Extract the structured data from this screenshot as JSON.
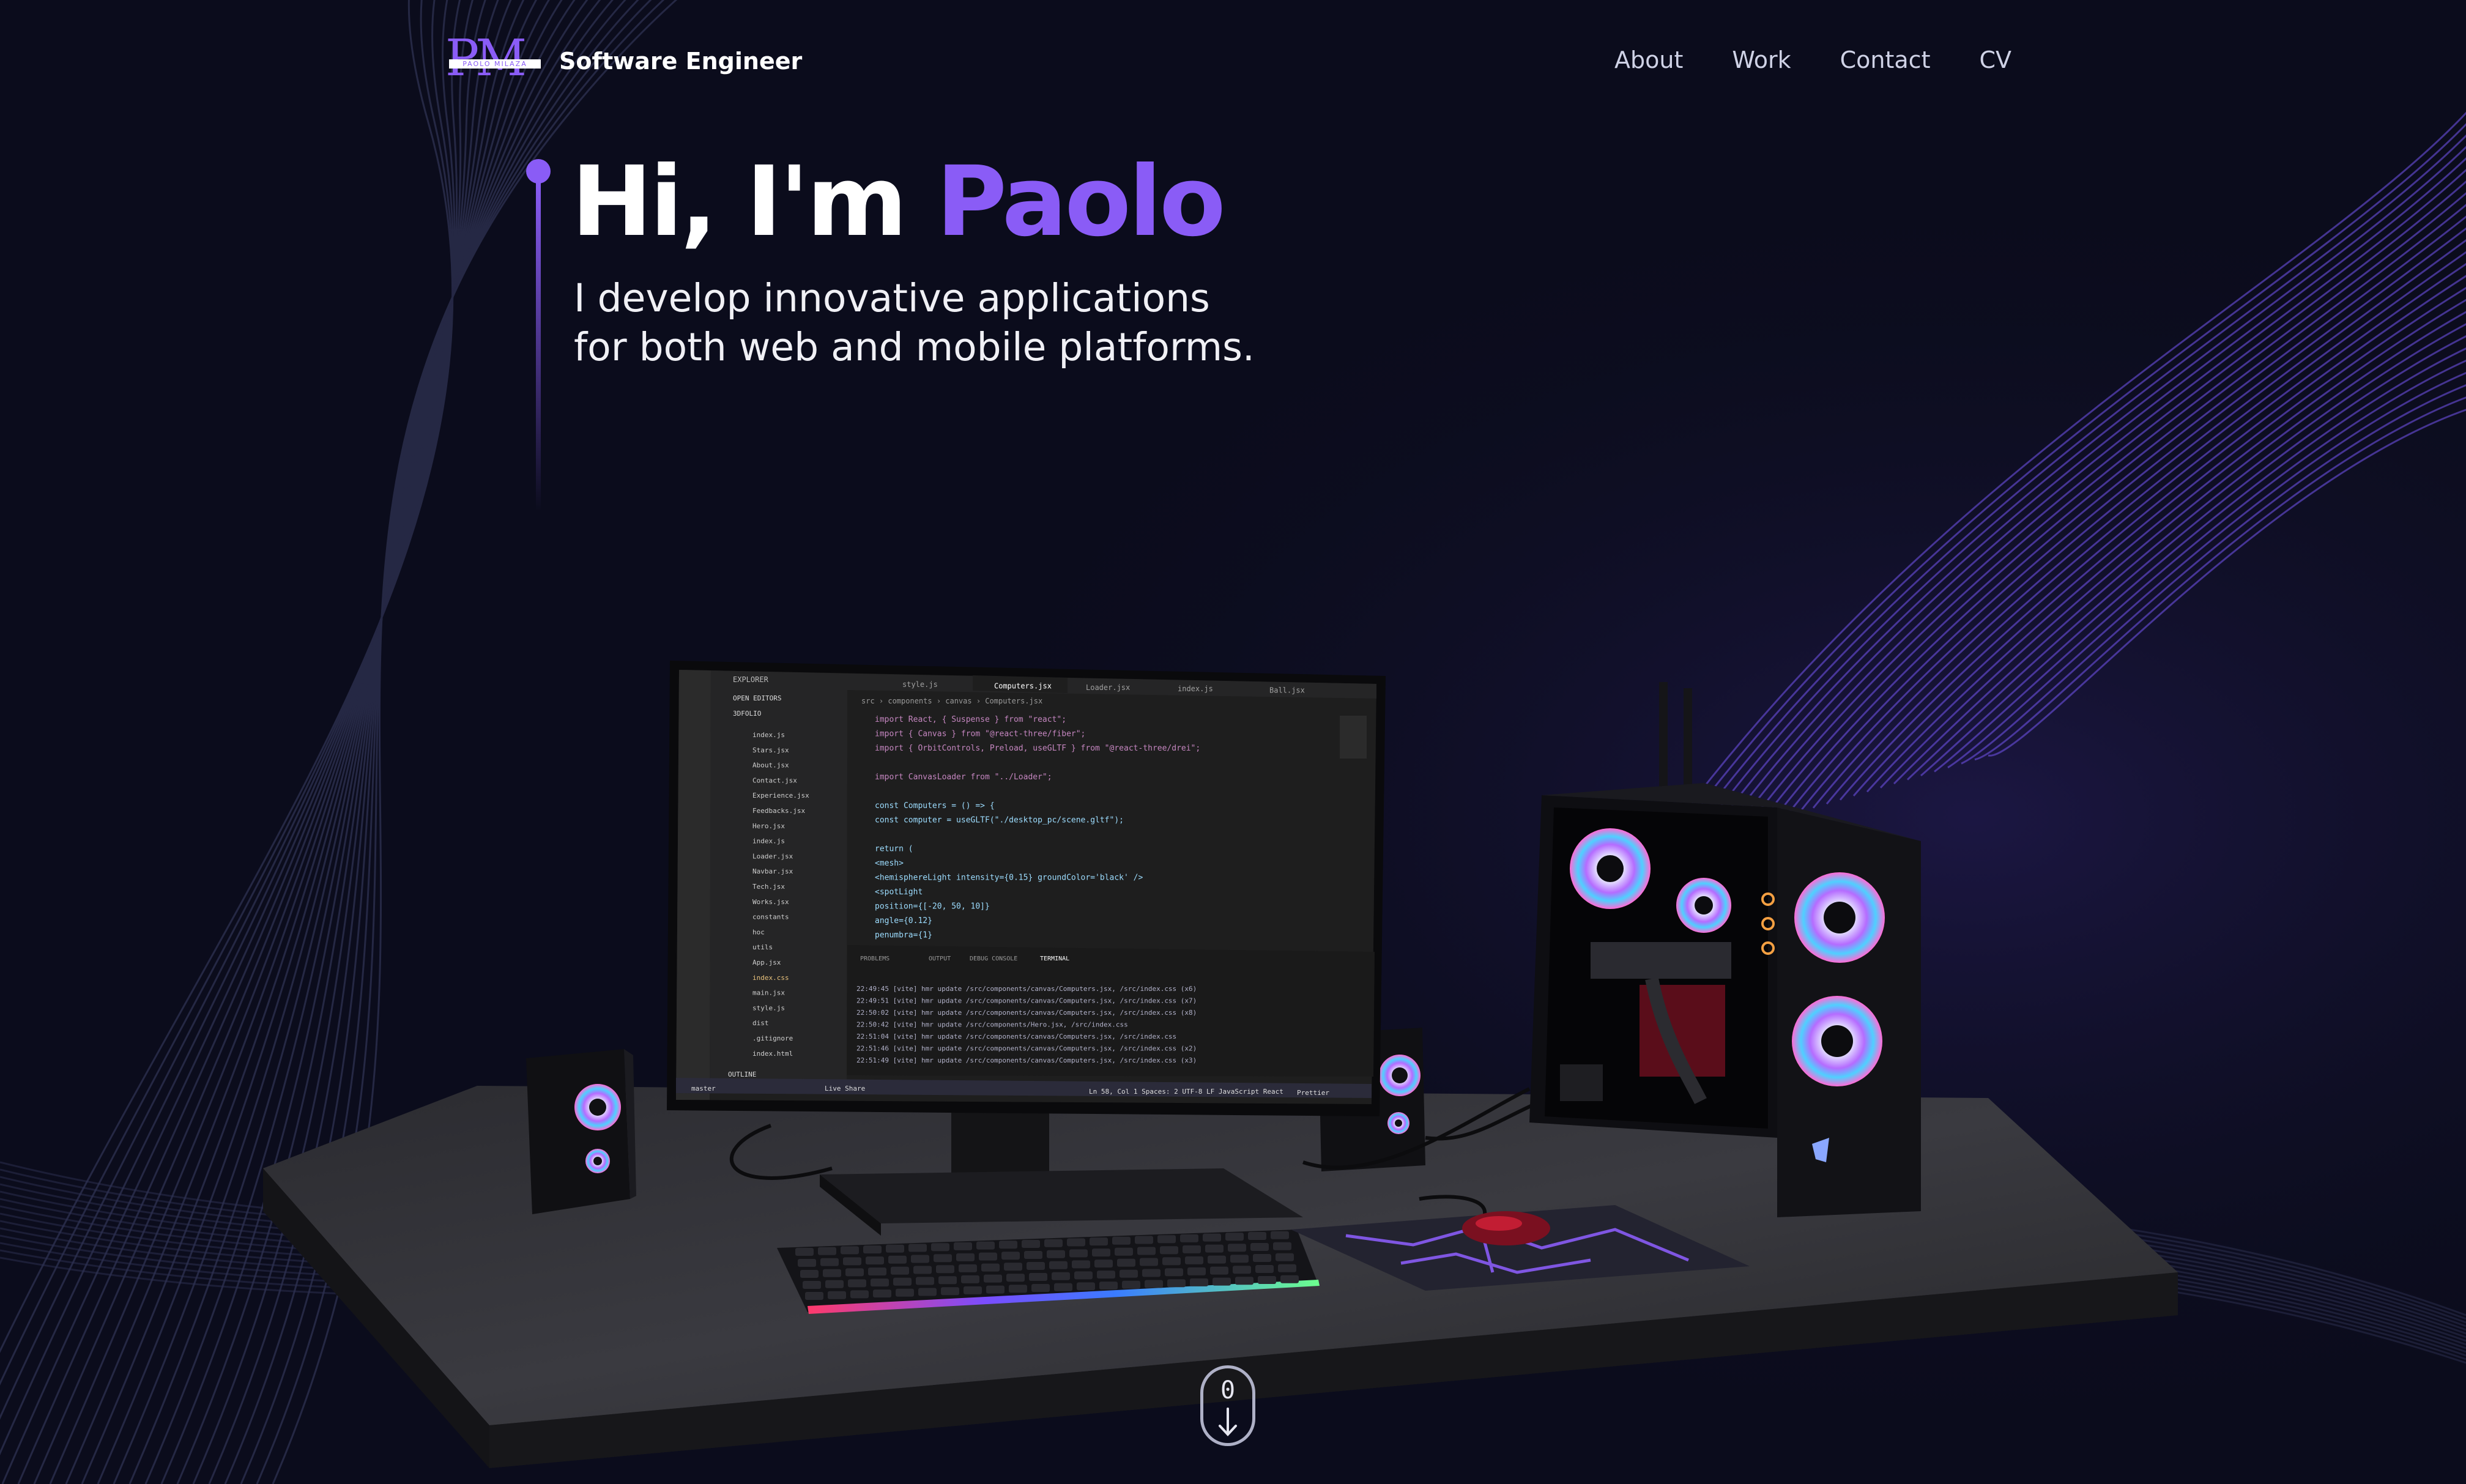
{
  "brand": {
    "logo_initials": "PM",
    "logo_band": "PAOLO MILAZA",
    "subtitle": "Software Engineer",
    "logo_icon": "pm-monogram-icon"
  },
  "nav": {
    "links": [
      "About",
      "Work",
      "Contact",
      "CV"
    ]
  },
  "hero": {
    "greeting": "Hi, I'm",
    "name": "Paolo",
    "line1": "I develop innovative applications",
    "line2": "for both web and mobile platforms."
  },
  "editor": {
    "explorer_label": "EXPLORER",
    "open_editors": "OPEN EDITORS",
    "project": "3DFOLIO",
    "files": [
      "index.js",
      "Stars.jsx",
      "About.jsx",
      "Contact.jsx",
      "Experience.jsx",
      "Feedbacks.jsx",
      "Hero.jsx",
      "index.js",
      "Loader.jsx",
      "Navbar.jsx",
      "Tech.jsx",
      "Works.jsx",
      "constants",
      "hoc",
      "utils",
      "App.jsx",
      "index.css",
      "main.jsx",
      "style.js",
      "dist",
      ".gitignore",
      "index.html"
    ],
    "outline": "OUTLINE",
    "tabs": [
      "style.js",
      "Computers.jsx",
      "Loader.jsx",
      "index.js",
      "Ball.jsx"
    ],
    "active_tab": "Computers.jsx",
    "breadcrumb": "src › components › canvas › Computers.jsx",
    "code": [
      "import React, { Suspense } from \"react\";",
      "import { Canvas } from \"@react-three/fiber\";",
      "import { OrbitControls, Preload, useGLTF } from \"@react-three/drei\";",
      "",
      "import CanvasLoader from \"../Loader\";",
      "",
      "const Computers = () => {",
      "  const computer = useGLTF(\"./desktop_pc/scene.gltf\");",
      "",
      "  return (",
      "    <mesh>",
      "      <hemisphereLight intensity={0.15} groundColor='black' />",
      "      <spotLight",
      "        position={[-20, 50, 10]}",
      "        angle={0.12}",
      "        penumbra={1}"
    ],
    "panel_tabs": [
      "PROBLEMS",
      "OUTPUT",
      "DEBUG CONSOLE",
      "TERMINAL"
    ],
    "terminal": [
      "22:49:45 [vite] hmr update /src/components/canvas/Computers.jsx, /src/index.css (x6)",
      "22:49:51 [vite] hmr update /src/components/canvas/Computers.jsx, /src/index.css (x7)",
      "22:50:02 [vite] hmr update /src/components/canvas/Computers.jsx, /src/index.css (x8)",
      "22:50:42 [vite] hmr update /src/components/Hero.jsx, /src/index.css",
      "22:51:04 [vite] hmr update /src/components/canvas/Computers.jsx, /src/index.css",
      "22:51:46 [vite] hmr update /src/components/canvas/Computers.jsx, /src/index.css (x2)",
      "22:51:49 [vite] hmr update /src/components/canvas/Computers.jsx, /src/index.css (x3)"
    ],
    "status_left": "master",
    "status_mid": "Ln 58, Col 1   Spaces: 2   UTF-8   LF   JavaScript React",
    "status_right": "Prettier",
    "live_share": "Live Share"
  },
  "scroll_indicator": {
    "digit": "0",
    "icon": "scroll-down-icon"
  },
  "colors": {
    "background": "#0b0c1c",
    "accent": "#8a5cf6",
    "nav_text": "#cfd2e6"
  }
}
